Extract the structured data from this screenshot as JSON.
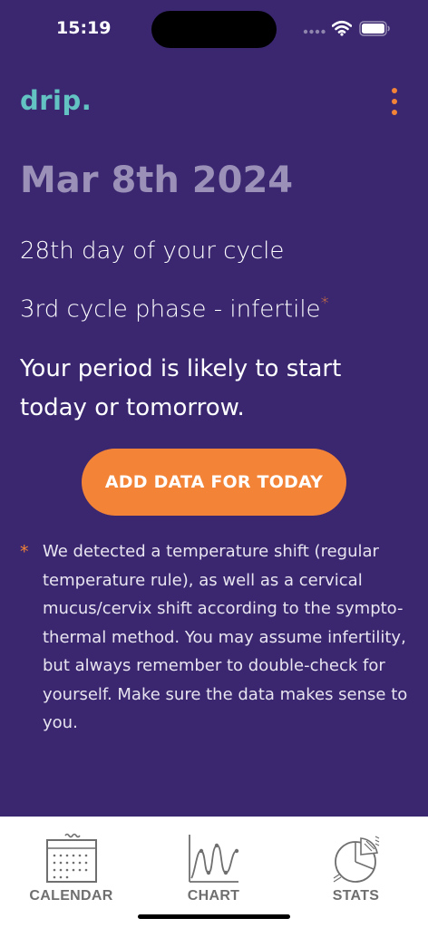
{
  "status_bar": {
    "time": "15:19",
    "icons": [
      "signal-icon",
      "wifi-icon",
      "battery-icon"
    ]
  },
  "header": {
    "logo": "drip.",
    "menu_icon": "more-vertical-icon"
  },
  "main": {
    "date": "Mar 8th 2024",
    "cycle_day": "28th day of your cycle",
    "cycle_phase": "3rd cycle phase - infertile",
    "phase_marker": "*",
    "prediction": "Your period is likely to start today or tomorrow.",
    "add_button_label": "ADD DATA FOR TODAY",
    "footnote_marker": "*",
    "footnote": "We detected a temperature shift (regular temperature rule), as well as a cervical mucus/cervix shift according to the sympto-thermal method. You may assume infertility, but always remember to double-check for yourself. Make sure the data makes sense to you."
  },
  "bottom_nav": {
    "items": [
      {
        "label": "CALENDAR",
        "icon": "calendar-icon"
      },
      {
        "label": "CHART",
        "icon": "chart-icon"
      },
      {
        "label": "STATS",
        "icon": "stats-icon"
      }
    ]
  },
  "colors": {
    "background": "#3a2770",
    "accent": "#f38337",
    "logo": "#62c3c2",
    "date": "#9b91b8"
  }
}
